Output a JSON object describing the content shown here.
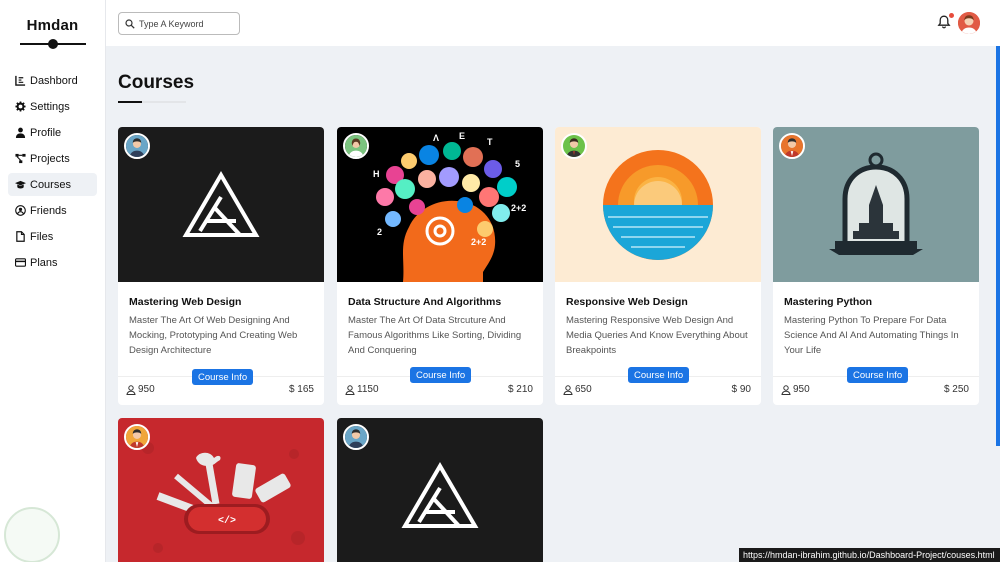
{
  "app": {
    "brand": "Hmdan"
  },
  "search": {
    "placeholder": "Type A Keyword"
  },
  "sidebar": {
    "items": [
      {
        "label": "Dashbord",
        "icon": "chart-icon"
      },
      {
        "label": "Settings",
        "icon": "gear-icon"
      },
      {
        "label": "Profile",
        "icon": "user-icon"
      },
      {
        "label": "Projects",
        "icon": "project-diagram-icon"
      },
      {
        "label": "Courses",
        "icon": "graduation-cap-icon",
        "active": true
      },
      {
        "label": "Friends",
        "icon": "friends-icon"
      },
      {
        "label": "Files",
        "icon": "file-icon"
      },
      {
        "label": "Plans",
        "icon": "credit-card-icon"
      }
    ]
  },
  "page": {
    "title": "Courses"
  },
  "courses": [
    {
      "title": "Mastering Web Design",
      "description": "Master The Art Of Web Designing And Mocking, Prototyping And Creating Web Design Architecture",
      "button": "Course Info",
      "students": "950",
      "price": "$ 165"
    },
    {
      "title": "Data Structure And Algorithms",
      "description": "Master The Art Of Data Strcuture And Famous Algorithms Like Sorting, Dividing And Conquering",
      "button": "Course Info",
      "students": "1150",
      "price": "$ 210"
    },
    {
      "title": "Responsive Web Design",
      "description": "Mastering Responsive Web Design And Media Queries And Know Everything About Breakpoints",
      "button": "Course Info",
      "students": "650",
      "price": "$ 90"
    },
    {
      "title": "Mastering Python",
      "description": "Mastering Python To Prepare For Data Science And AI And Automating Things In Your Life",
      "button": "Course Info",
      "students": "950",
      "price": "$ 250"
    }
  ],
  "status_url": "https://hmdan-ibrahim.github.io/Dashboard-Project/couses.html",
  "colors": {
    "accent": "#1b74e4",
    "notification": "#e74c3c"
  }
}
